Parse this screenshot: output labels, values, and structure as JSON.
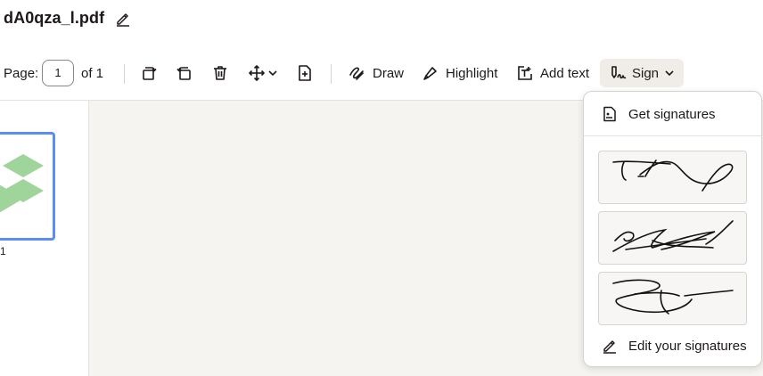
{
  "document": {
    "filename": "dA0qza_l.pdf"
  },
  "toolbar": {
    "page_label": "Page:",
    "page_value": "1",
    "page_total": "of 1",
    "draw_label": "Draw",
    "highlight_label": "Highlight",
    "add_text_label": "Add text",
    "sign_label": "Sign"
  },
  "thumbnails": [
    {
      "label": "1"
    }
  ],
  "sign_menu": {
    "get_signatures_label": "Get signatures",
    "signatures": [
      "signature-1",
      "signature-2",
      "signature-3"
    ],
    "edit_signatures_label": "Edit your signatures"
  },
  "colors": {
    "accent": "#5b8df6",
    "canvas": "#f5f4f1",
    "thumb_shape": "#9fd49a"
  }
}
